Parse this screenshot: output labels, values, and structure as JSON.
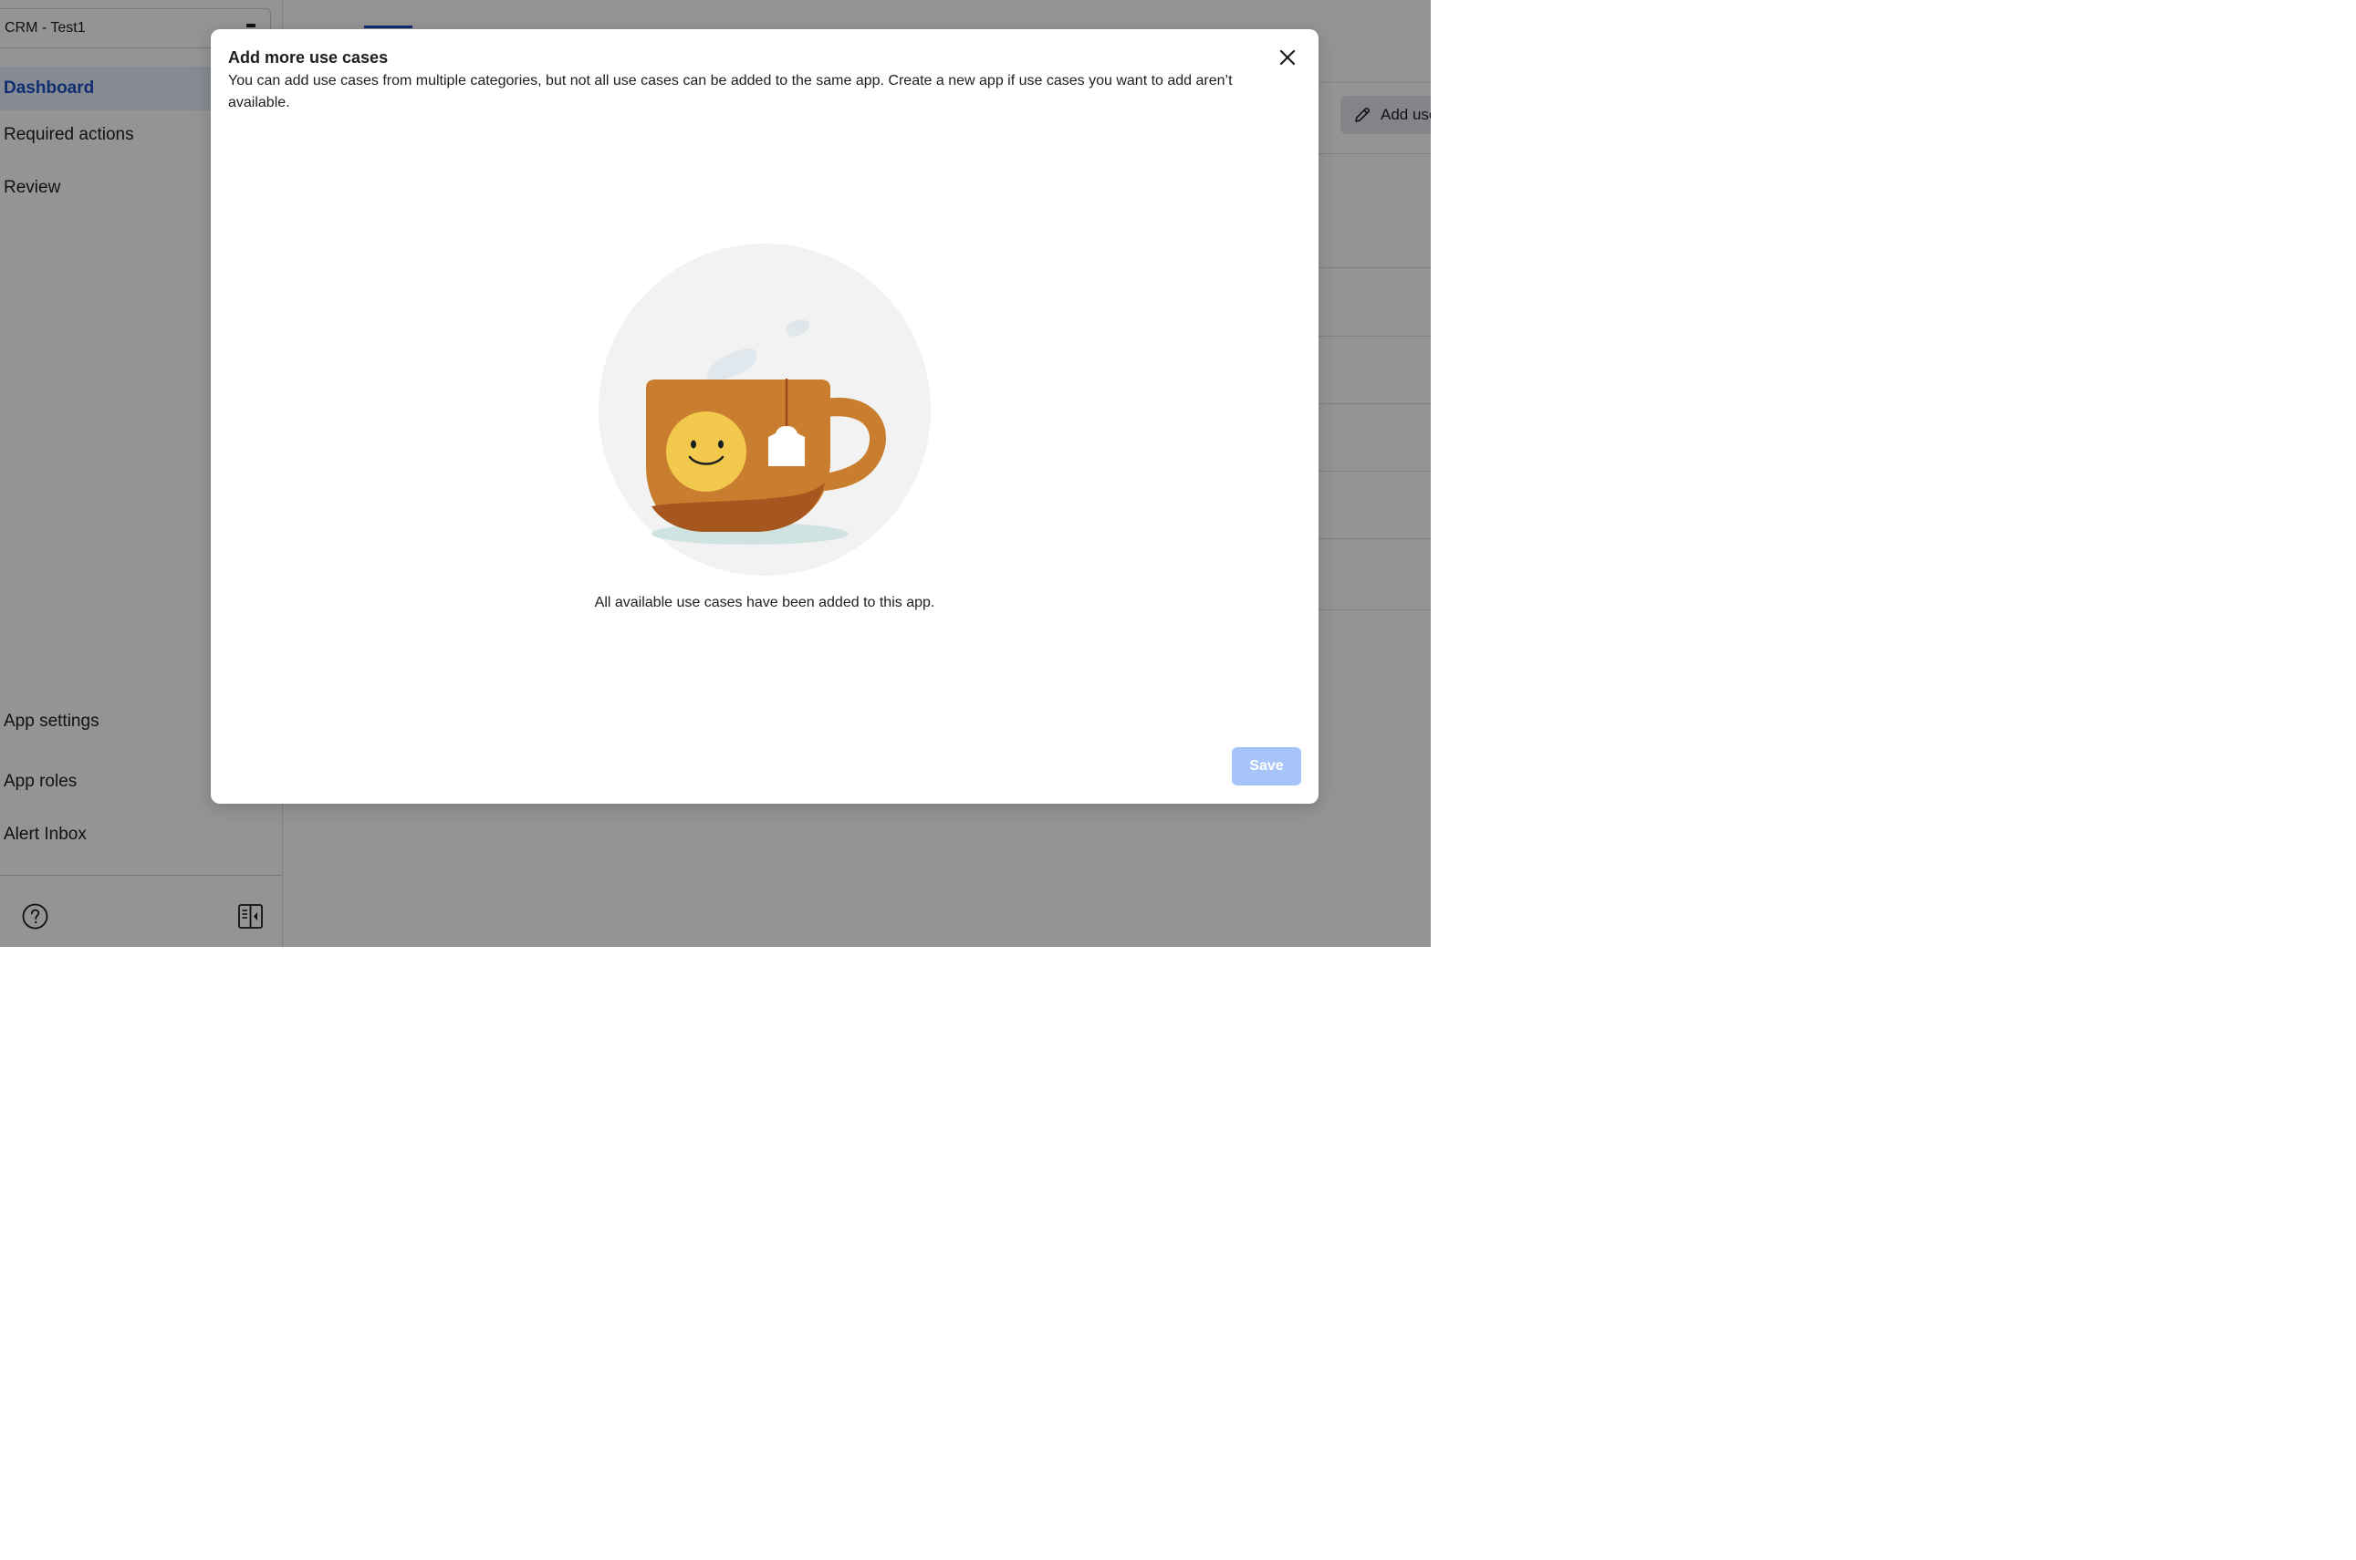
{
  "sidebar": {
    "app_selector": {
      "name": "CRM - Test1"
    },
    "items": [
      {
        "label": "Dashboard",
        "active": true
      },
      {
        "label": "Required actions",
        "active": false
      },
      {
        "label": "Review",
        "active": false
      }
    ],
    "bottom_items": [
      {
        "label": "App settings"
      },
      {
        "label": "App roles"
      },
      {
        "label": "Alert Inbox"
      }
    ],
    "icons": {
      "help": "help-circle-icon",
      "collapse": "sidebar-collapse-icon"
    }
  },
  "main": {
    "add_use_cases_button": {
      "label": "Add use cases",
      "icon": "pencil-icon"
    }
  },
  "modal": {
    "title": "Add more use cases",
    "description": "You can add use cases from multiple categories, but not all use cases can be added to the same app. Create a new app if use cases you want to add aren’t available.",
    "empty_message": "All available use cases have been added to this app.",
    "save_label": "Save",
    "close_icon": "close-icon",
    "illustration": "smiling-tea-cup-illustration"
  },
  "colors": {
    "accent": "#1a4fc1",
    "active_bg": "#e7f0fd",
    "save_disabled": "#a7c4fa",
    "cup": "#c97e2f",
    "cup_face": "#f2c94c"
  }
}
